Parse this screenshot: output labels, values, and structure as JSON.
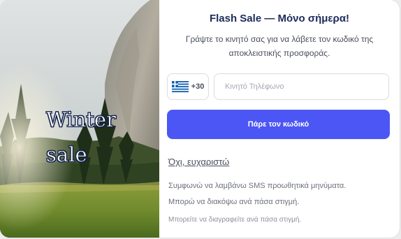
{
  "hero": {
    "headline_line1": "Winter",
    "headline_line2": "sale"
  },
  "popup": {
    "title": "Flash Sale — Μόνο σήμερα!",
    "subtitle": "Γράψτε το κινητό σας για να λάβετε τον κωδικό της αποκλειστικής προσφοράς.",
    "country": {
      "flag_icon": "greece-flag-icon",
      "dial_code": "+30"
    },
    "phone_placeholder": "Κινητό Τηλέφωνο",
    "submit_label": "Πάρε τον κωδικό",
    "decline_label": "Όχι, ευχαριστώ",
    "consent_line1": "Συμφωνώ να λαμβάνω SMS προωθητικά μηνύματα.",
    "consent_line2": "Μπορώ να διακόψω ανά πάσα στιγμή.",
    "footnote": "Μπορείτε να διαγραφείτε ανά πάσα στιγμή."
  },
  "colors": {
    "button": "#4b56f5",
    "title": "#1c2b5a",
    "greece_blue": "#0d5eaf"
  }
}
